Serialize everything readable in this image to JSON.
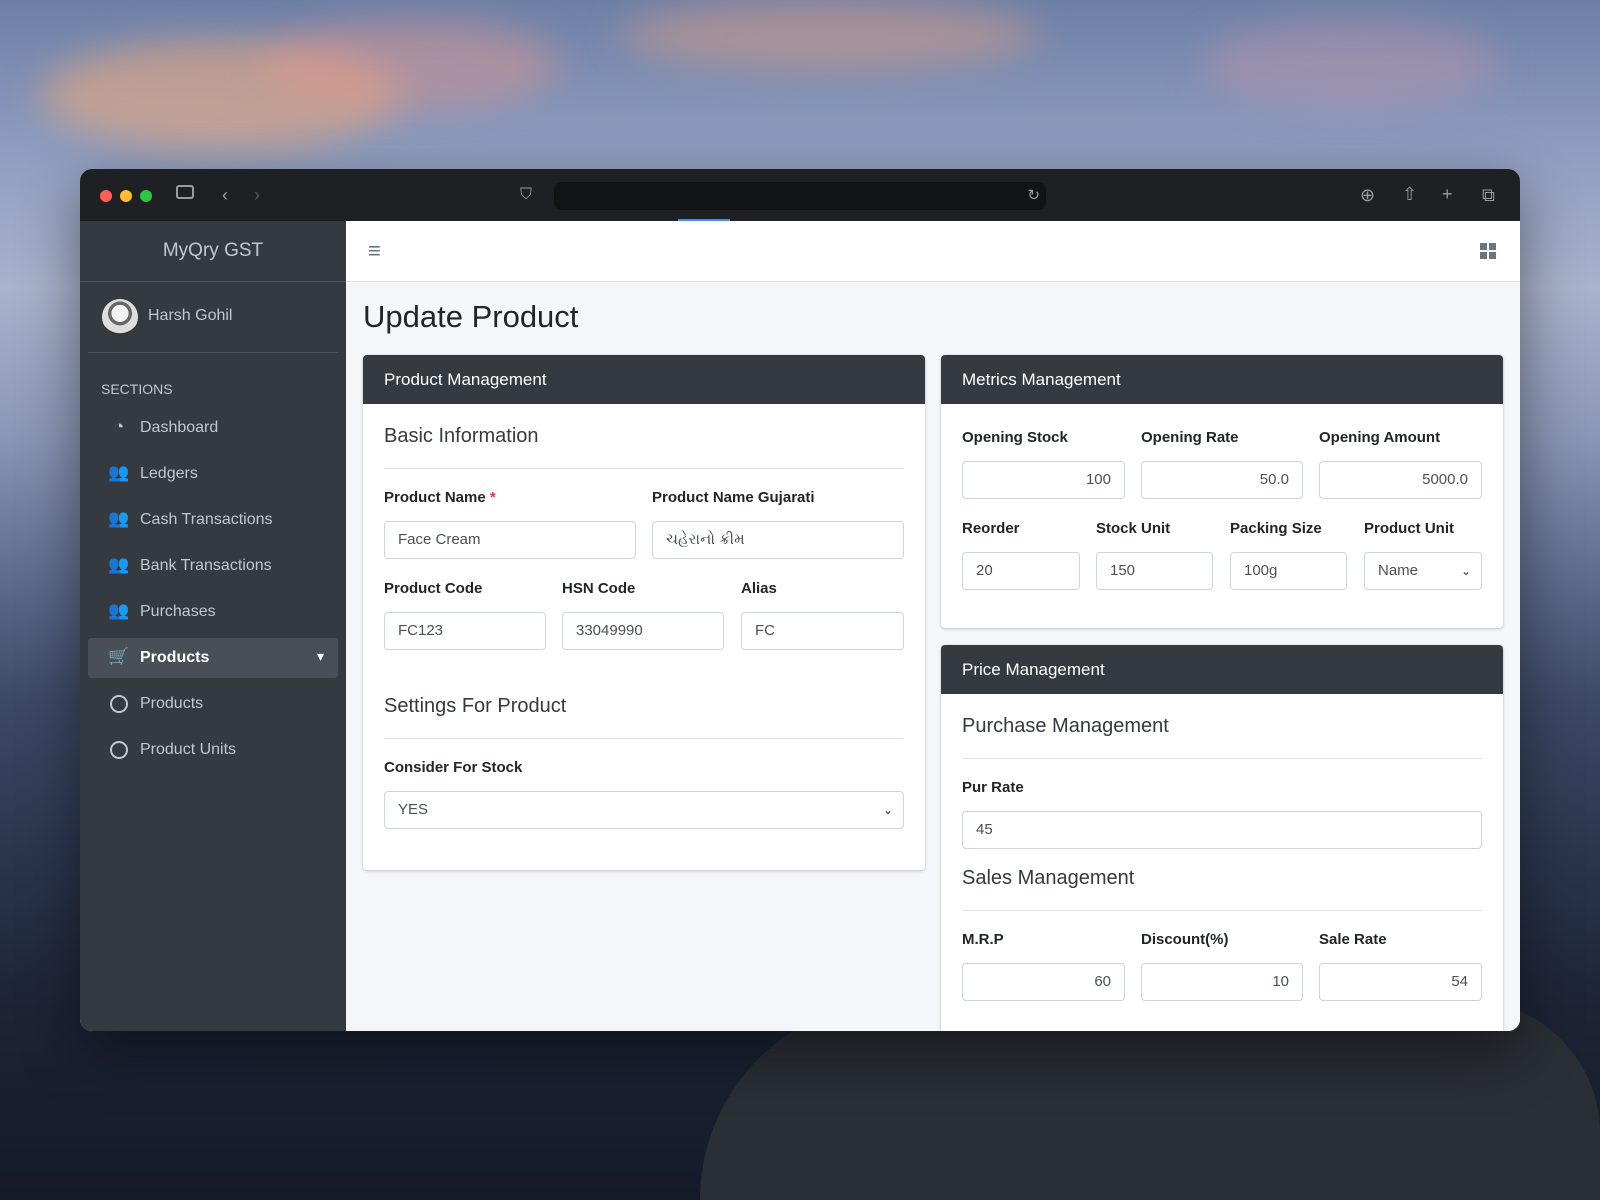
{
  "app": {
    "brand": "MyQry GST"
  },
  "user": {
    "name": "Harsh Gohil"
  },
  "sidebar": {
    "section_header": "SECTIONS",
    "items": [
      {
        "label": "Dashboard",
        "icon": "dashboard-gauge-icon"
      },
      {
        "label": "Ledgers",
        "icon": "users-icon"
      },
      {
        "label": "Cash Transactions",
        "icon": "users-icon"
      },
      {
        "label": "Bank Transactions",
        "icon": "users-icon"
      },
      {
        "label": "Purchases",
        "icon": "users-icon"
      },
      {
        "label": "Products",
        "icon": "cart-icon",
        "active": true,
        "expanded": true
      },
      {
        "label": "Products",
        "icon": "circle-icon"
      },
      {
        "label": "Product Units",
        "icon": "circle-icon"
      }
    ]
  },
  "page": {
    "title": "Update Product"
  },
  "product_card": {
    "header": "Product Management",
    "basic_title": "Basic Information",
    "product_name": {
      "label": "Product Name",
      "required_mark": "*",
      "value": "Face Cream"
    },
    "product_name_gujarati": {
      "label": "Product Name Gujarati",
      "value": "ચહેરાનો ક્રીમ"
    },
    "product_code": {
      "label": "Product Code",
      "value": "FC123"
    },
    "hsn_code": {
      "label": "HSN Code",
      "value": "33049990"
    },
    "alias": {
      "label": "Alias",
      "value": "FC"
    },
    "settings_title": "Settings For Product",
    "consider_for_stock": {
      "label": "Consider For Stock",
      "value": "YES"
    }
  },
  "metrics_card": {
    "header": "Metrics Management",
    "opening_stock": {
      "label": "Opening Stock",
      "value": "100"
    },
    "opening_rate": {
      "label": "Opening Rate",
      "value": "50.0"
    },
    "opening_amount": {
      "label": "Opening Amount",
      "value": "5000.0"
    },
    "reorder": {
      "label": "Reorder",
      "value": "20"
    },
    "stock_unit": {
      "label": "Stock Unit",
      "value": "150"
    },
    "packing_size": {
      "label": "Packing Size",
      "value": "100g"
    },
    "product_unit": {
      "label": "Product Unit",
      "value": "Name"
    }
  },
  "price_card": {
    "header": "Price Management",
    "purchase_title": "Purchase Management",
    "pur_rate": {
      "label": "Pur Rate",
      "value": "45"
    },
    "sales_title": "Sales Management",
    "mrp": {
      "label": "M.R.P",
      "value": "60"
    },
    "discount": {
      "label": "Discount(%)",
      "value": "10"
    },
    "sale_rate": {
      "label": "Sale Rate",
      "value": "54"
    }
  }
}
